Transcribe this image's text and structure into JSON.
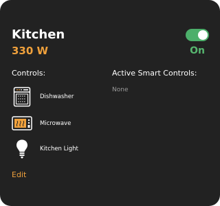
{
  "room": {
    "title": "Kitchen",
    "power": "330 W",
    "toggle_status": "On",
    "toggle_on": true
  },
  "controls": {
    "heading": "Controls:",
    "devices": [
      {
        "label": "Dishwasher",
        "icon": "dishwasher-icon"
      },
      {
        "label": "Microwave",
        "icon": "microwave-icon"
      },
      {
        "label": "Kitchen Light",
        "icon": "light-bulb-icon"
      }
    ]
  },
  "smart_controls": {
    "heading": "Active Smart Controls:",
    "empty_text": "None"
  },
  "actions": {
    "edit_label": "Edit"
  },
  "colors": {
    "card_bg": "#222222",
    "accent_orange": "#f0a13c",
    "toggle_green": "#4caf6a",
    "status_green": "#57b66f",
    "muted_text": "#9a9a9a"
  }
}
